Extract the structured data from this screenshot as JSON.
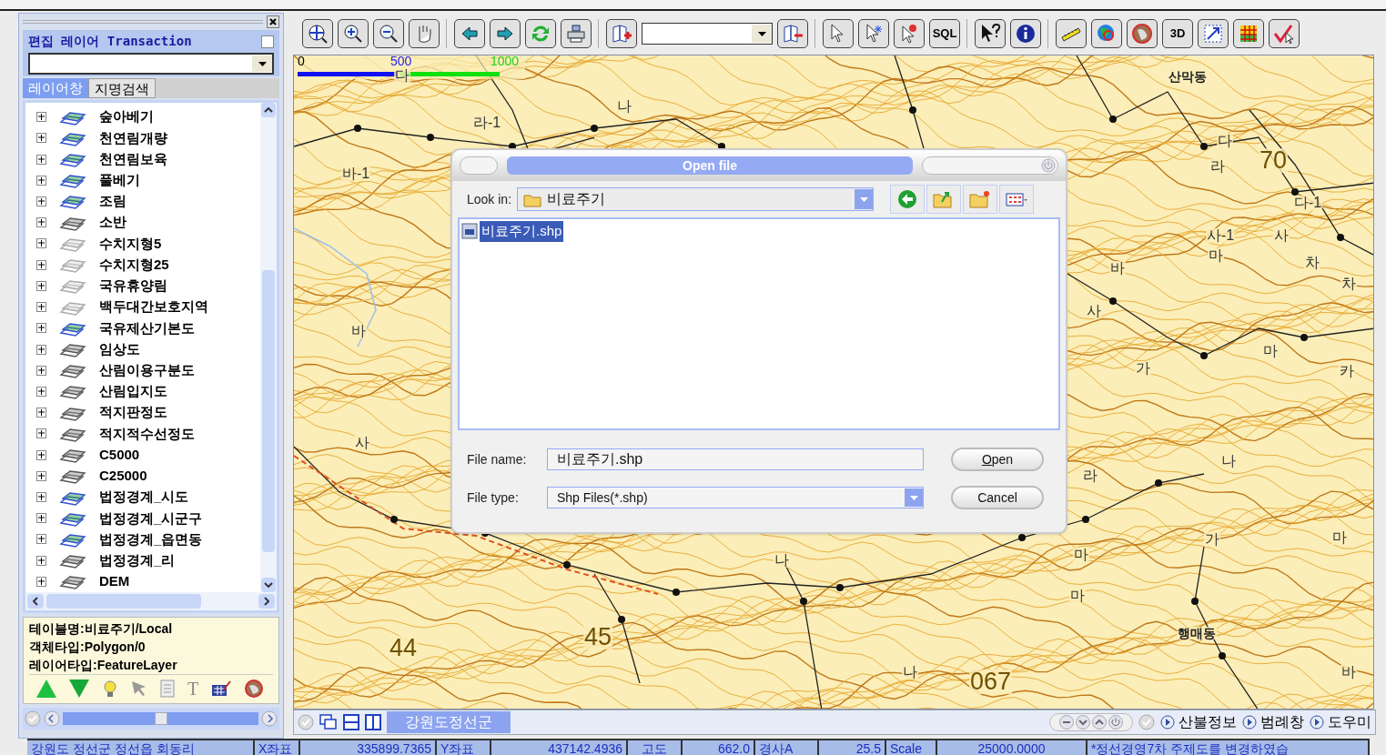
{
  "left_panel": {
    "edit_layer": {
      "label": "편집 레이어 Transaction",
      "transaction_checked": false
    },
    "tabs": [
      {
        "label": "레이어창",
        "selected": true
      },
      {
        "label": "지명검색",
        "selected": false
      }
    ],
    "layers": [
      {
        "name": "숲아베기",
        "expanded": false,
        "kind": "colored"
      },
      {
        "name": "천연림개량",
        "expanded": false,
        "kind": "colored"
      },
      {
        "name": "천연림보육",
        "expanded": false,
        "kind": "colored"
      },
      {
        "name": "풀베기",
        "expanded": false,
        "kind": "colored"
      },
      {
        "name": "조림",
        "expanded": false,
        "kind": "colored"
      },
      {
        "name": "소반",
        "expanded": false,
        "kind": "plain"
      },
      {
        "name": "수치지형5",
        "expanded": false,
        "kind": "grey"
      },
      {
        "name": "수치지형25",
        "expanded": false,
        "kind": "grey"
      },
      {
        "name": "국유휴양림",
        "expanded": false,
        "kind": "grey"
      },
      {
        "name": "백두대간보호지역",
        "expanded": false,
        "kind": "grey"
      },
      {
        "name": "국유제산기본도",
        "expanded": false,
        "kind": "colored"
      },
      {
        "name": "임상도",
        "expanded": false,
        "kind": "plain"
      },
      {
        "name": "산림이용구분도",
        "expanded": false,
        "kind": "plain"
      },
      {
        "name": "산림입지도",
        "expanded": false,
        "kind": "plain"
      },
      {
        "name": "적지판정도",
        "expanded": false,
        "kind": "plain"
      },
      {
        "name": "적지적수선정도",
        "expanded": false,
        "kind": "plain"
      },
      {
        "name": "C5000",
        "expanded": false,
        "kind": "plain"
      },
      {
        "name": "C25000",
        "expanded": false,
        "kind": "plain"
      },
      {
        "name": "법정경계_시도",
        "expanded": false,
        "kind": "colored"
      },
      {
        "name": "법정경계_시군구",
        "expanded": false,
        "kind": "colored"
      },
      {
        "name": "법정경계_읍면동",
        "expanded": false,
        "kind": "colored"
      },
      {
        "name": "법정경계_리",
        "expanded": false,
        "kind": "plain"
      },
      {
        "name": "DEM",
        "expanded": false,
        "kind": "plain"
      }
    ],
    "info": [
      "테이블명:비료주기/Local",
      "객체타입:Polygon/0",
      "레이어타입:FeatureLayer"
    ],
    "text_tool": "T"
  },
  "toolbar": {
    "sql_label": "SQL",
    "3d_label": "3D"
  },
  "map": {
    "scale_bar": [
      "0",
      "500",
      "1000"
    ],
    "labels": [
      {
        "text": "바-1",
        "kind": "place"
      },
      {
        "text": "라-1",
        "kind": "place"
      },
      {
        "text": "나",
        "kind": "place"
      },
      {
        "text": "다",
        "kind": "place"
      },
      {
        "text": "산막동",
        "kind": "village"
      },
      {
        "text": "다",
        "kind": "place"
      },
      {
        "text": "라",
        "kind": "place"
      },
      {
        "text": "70",
        "kind": "grid"
      },
      {
        "text": "다-1",
        "kind": "place"
      },
      {
        "text": "사-1",
        "kind": "place"
      },
      {
        "text": "마",
        "kind": "place"
      },
      {
        "text": "사",
        "kind": "place"
      },
      {
        "text": "차",
        "kind": "place"
      },
      {
        "text": "차",
        "kind": "place"
      },
      {
        "text": "바",
        "kind": "place"
      },
      {
        "text": "사",
        "kind": "place"
      },
      {
        "text": "바",
        "kind": "place"
      },
      {
        "text": "마",
        "kind": "place"
      },
      {
        "text": "가",
        "kind": "place"
      },
      {
        "text": "카",
        "kind": "place"
      },
      {
        "text": "사",
        "kind": "place"
      },
      {
        "text": "라",
        "kind": "place"
      },
      {
        "text": "나",
        "kind": "place"
      },
      {
        "text": "가",
        "kind": "place"
      },
      {
        "text": "마",
        "kind": "place"
      },
      {
        "text": "마",
        "kind": "place"
      },
      {
        "text": "나",
        "kind": "place"
      },
      {
        "text": "마",
        "kind": "place"
      },
      {
        "text": "44",
        "kind": "grid"
      },
      {
        "text": "45",
        "kind": "grid"
      },
      {
        "text": "행매동",
        "kind": "village"
      },
      {
        "text": "나",
        "kind": "place"
      },
      {
        "text": "067",
        "kind": "grid"
      },
      {
        "text": "바",
        "kind": "place"
      }
    ]
  },
  "dialog": {
    "title": "Open file",
    "look_in_label": "Look in:",
    "look_in_value": "비료주기",
    "files": [
      {
        "name": "비료주기.shp",
        "selected": true
      }
    ],
    "file_name_label": "File name:",
    "file_name_value": "비료주기.shp",
    "file_type_label": "File type:",
    "file_type_value": "Shp Files(*.shp)",
    "buttons": [
      "Open",
      "Cancel"
    ]
  },
  "map_bar": {
    "tab": "강원도정선군",
    "links": [
      "산불정보",
      "범례창",
      "도우미"
    ]
  },
  "status_bar": [
    "강원도 정선군 정선읍 회동리",
    "X좌표",
    "335899.7365",
    "Y좌표",
    "437142.4936",
    "고도",
    "662.0",
    "경사A",
    "25.5",
    "Scale",
    "25000.0000",
    "*정선경영7차 주제도를 변경하였습"
  ]
}
